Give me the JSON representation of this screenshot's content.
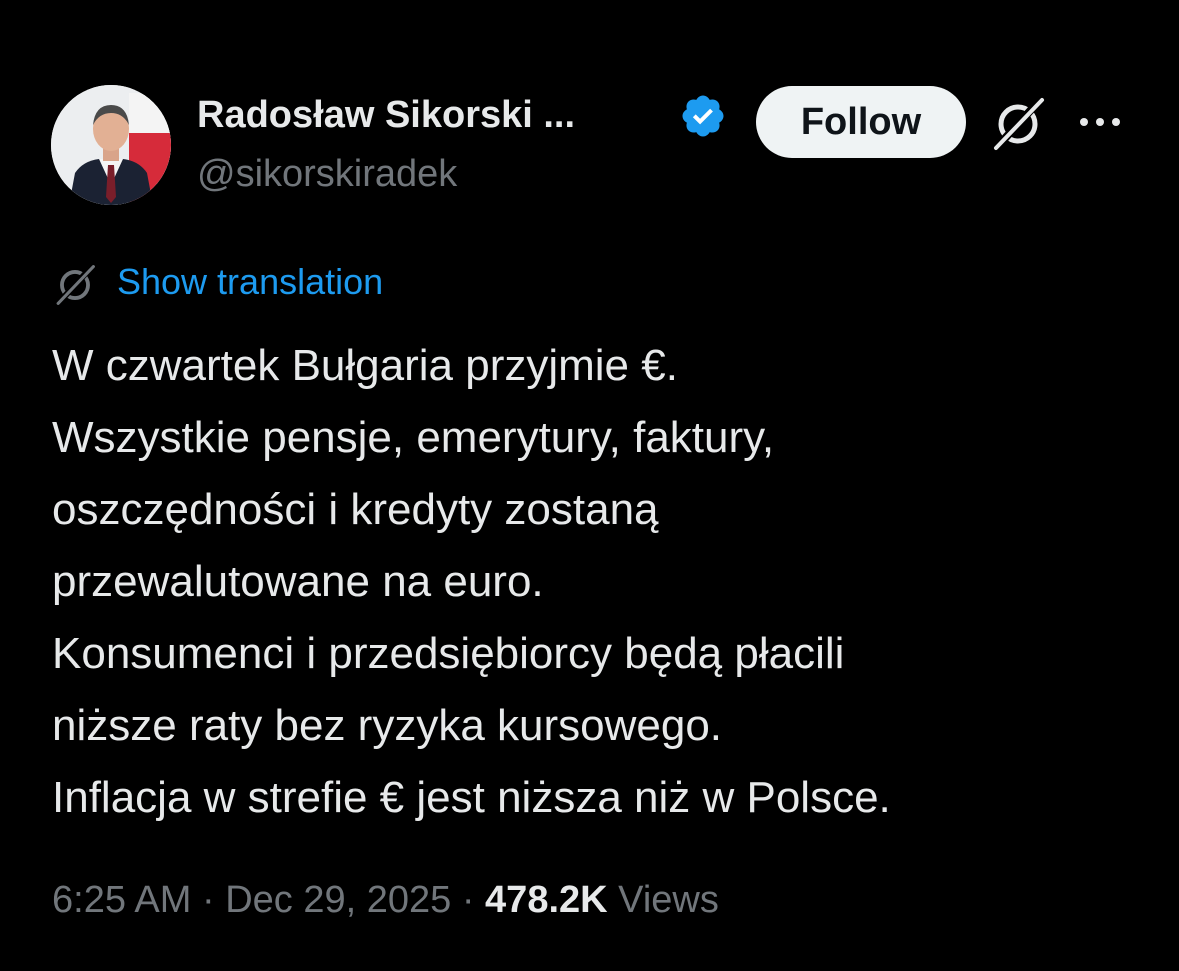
{
  "author": {
    "name": "Radosław Sikorski ...",
    "handle": "@sikorskiradek",
    "verified_color": "#1d9bf0",
    "avatar_icon": "profile-photo"
  },
  "actions": {
    "follow_label": "Follow",
    "grok_icon": "grok-icon",
    "more_icon": "more-horizontal-icon"
  },
  "translation": {
    "label": "Show translation",
    "icon": "grok-icon"
  },
  "tweet": {
    "lines": [
      "W czwartek Bułgaria przyjmie €.",
      "Wszystkie pensje, emerytury, faktury,",
      "oszczędności i kredyty zostaną",
      "przewalutowane na euro.",
      "Konsumenci i przedsiębiorcy będą płacili",
      "niższe raty bez ryzyka kursowego.",
      "Inflacja w strefie € jest niższa niż w Polsce."
    ]
  },
  "meta": {
    "time": "6:25 AM",
    "separator": "·",
    "date": "Dec 29, 2025",
    "views_count": "478.2K",
    "views_label": "Views"
  },
  "colors": {
    "background": "#000000",
    "text": "#e7e9ea",
    "secondary": "#71767b",
    "link": "#1d9bf0",
    "follow_bg": "#eff3f4"
  }
}
